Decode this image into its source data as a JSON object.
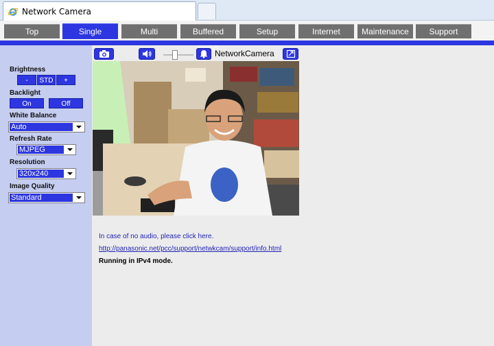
{
  "browser": {
    "tab_title": "Network Camera"
  },
  "nav": {
    "tabs": [
      {
        "label": "Top"
      },
      {
        "label": "Single",
        "active": true
      },
      {
        "label": "Multi"
      },
      {
        "label": "Buffered Image"
      },
      {
        "label": "Setup"
      },
      {
        "label": "Internet"
      },
      {
        "label": "Maintenance"
      },
      {
        "label": "Support"
      }
    ]
  },
  "sidebar": {
    "brightness_label": "Brightness",
    "brightness_minus": "-",
    "brightness_std": "STD",
    "brightness_plus": "+",
    "backlight_label": "Backlight",
    "backlight_on": "On",
    "backlight_off": "Off",
    "white_balance_label": "White Balance",
    "white_balance_value": "Auto",
    "refresh_rate_label": "Refresh Rate",
    "refresh_rate_value": "MJPEG",
    "resolution_label": "Resolution",
    "resolution_value": "320x240",
    "image_quality_label": "Image Quality",
    "image_quality_value": "Standard"
  },
  "camera": {
    "name": "NetworkCamera",
    "icons": [
      "camera-icon",
      "speaker-icon",
      "bell-icon",
      "fullscreen-icon"
    ]
  },
  "info": {
    "no_audio": "In case of no audio, please click here.",
    "support_url": "http://panasonic.net/pcc/support/netwkcam/support/info.html",
    "ip_mode": "Running in IPv4 mode."
  },
  "colors": {
    "accent": "#2d36e0",
    "nav_inactive": "#707070",
    "sidebar_bg": "#c5cdf0"
  }
}
